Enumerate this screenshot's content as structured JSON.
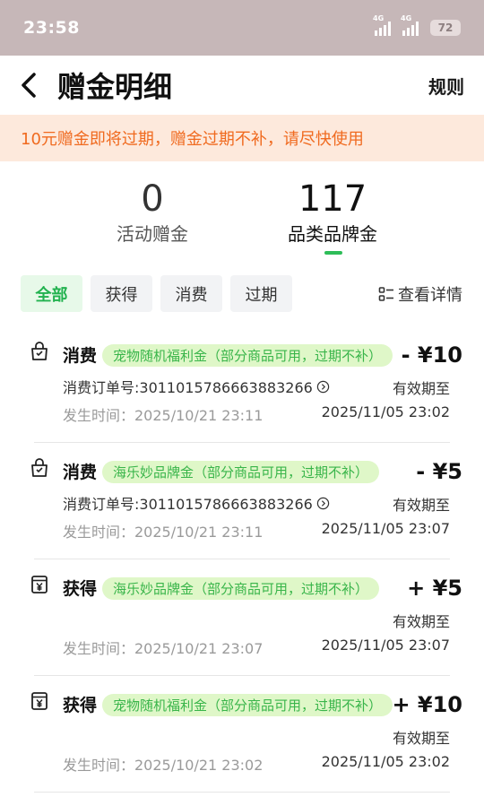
{
  "status_bar": {
    "time": "23:58",
    "network_1": "4G",
    "network_2": "4G",
    "battery": "72"
  },
  "header": {
    "title": "赠金明细",
    "rules": "规则"
  },
  "notice": "10元赠金即将过期，赠金过期不补，请尽快使用",
  "stats": [
    {
      "value": "0",
      "label": "活动赠金"
    },
    {
      "value": "117",
      "label": "品类品牌金"
    }
  ],
  "filters": {
    "all": "全部",
    "earned": "获得",
    "spent": "消费",
    "expired": "过期",
    "detail": "查看详情"
  },
  "records": [
    {
      "icon": "shopping-bag-icon",
      "type": "消费",
      "tag": "宠物随机福利金（部分商品可用，过期不补）",
      "amount": "- ¥10",
      "order": "消费订单号:3011015786663883266",
      "valid_label": "有效期至",
      "time": "发生时间：2025/10/21 23:11",
      "valid_until": "2025/11/05 23:02"
    },
    {
      "icon": "shopping-bag-icon",
      "type": "消费",
      "tag": "海乐妙品牌金（部分商品可用，过期不补）",
      "amount": "- ¥5",
      "order": "消费订单号:3011015786663883266",
      "valid_label": "有效期至",
      "time": "发生时间：2025/10/21 23:11",
      "valid_until": "2025/11/05 23:07"
    },
    {
      "icon": "wallet-yuan-icon",
      "type": "获得",
      "tag": "海乐妙品牌金（部分商品可用，过期不补）",
      "amount": "+ ¥5",
      "order": "",
      "valid_label": "有效期至",
      "time": "发生时间：2025/10/21 23:07",
      "valid_until": "2025/11/05 23:07"
    },
    {
      "icon": "wallet-yuan-icon",
      "type": "获得",
      "tag": "宠物随机福利金（部分商品可用，过期不补）",
      "amount": "+ ¥10",
      "order": "",
      "valid_label": "有效期至",
      "time": "发生时间：2025/10/21 23:02",
      "valid_until": "2025/11/05 23:02"
    }
  ],
  "colors": {
    "accent": "#2dbd58",
    "notice_bg": "#fde9dc",
    "notice_text": "#f06a1f",
    "tag_bg": "#dff7c8",
    "tag_text": "#39b54a"
  }
}
